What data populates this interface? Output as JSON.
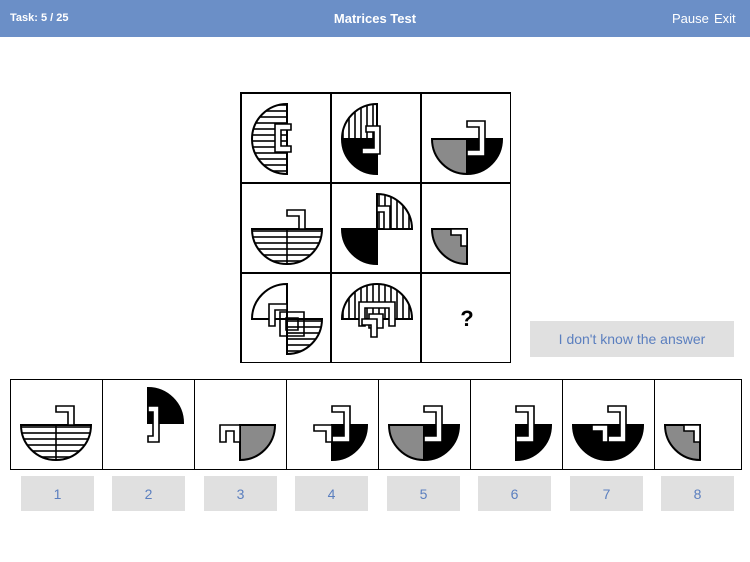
{
  "header": {
    "task_label": "Task: 5 / 25",
    "title": "Matrices Test",
    "pause_label": "Pause",
    "exit_label": "Exit"
  },
  "matrix": {
    "question_mark": "?"
  },
  "idk_button_label": "I don't know the answer",
  "answer_options": [
    "1",
    "2",
    "3",
    "4",
    "5",
    "6",
    "7",
    "8"
  ],
  "colors": {
    "header_bg": "#6b8fc7",
    "button_bg": "#e0e0e0",
    "button_text": "#5b7fbf",
    "gray_fill": "#8a8a8a"
  }
}
